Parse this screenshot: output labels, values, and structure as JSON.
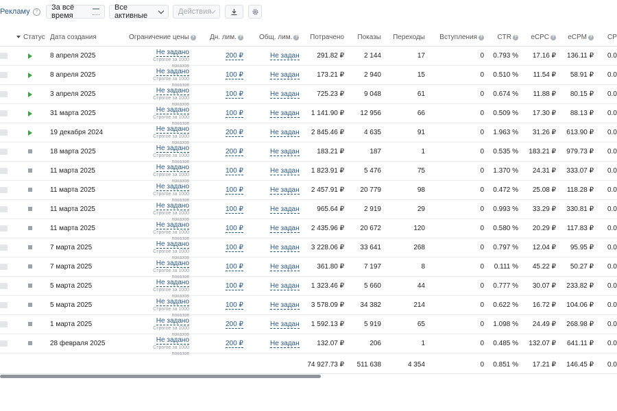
{
  "toolbar": {
    "create_label": "Рекламу",
    "period_label": "За всё время",
    "filter_label": "Все активные",
    "actions_label": "Действия",
    "help_glyph": "?"
  },
  "icons": {
    "calendar": "calendar-icon",
    "download": "download-icon",
    "settings": "gear-icon"
  },
  "columns": {
    "status": "Статус",
    "created": "Дата создания",
    "price_limit": "Ограничение цены",
    "daily_limit": "Дн. лим.",
    "total_limit": "Общ. лим.",
    "spent": "Потрачено",
    "views": "Показы",
    "clicks": "Переходы",
    "joins": "Вступления",
    "ctr": "CTR",
    "ecpc": "eCPC",
    "ecpm": "eCPM",
    "cpj": "CPJ"
  },
  "colors": {
    "link": "#2a5885",
    "active": "#3aa541",
    "stopped": "#99a2ad"
  },
  "rows": [
    {
      "status": "active",
      "created": "8 апреля 2025",
      "lim": "Не задано",
      "lim_note": "Строгое за 1000 показов",
      "daily": "200 ₽",
      "total_lim": "Не задан",
      "spent": "291.82 ₽",
      "views": "2 144",
      "clicks": "17",
      "joins": "0",
      "ctr": "0.793 %",
      "ecpc": "17.16 ₽",
      "ecpm": "136.11 ₽",
      "cpj": "0.0"
    },
    {
      "status": "active",
      "created": "8 апреля 2025",
      "lim": "Не задано",
      "lim_note": "Строгое за 1000 показов",
      "daily": "100 ₽",
      "total_lim": "Не задан",
      "spent": "173.21 ₽",
      "views": "2 940",
      "clicks": "15",
      "joins": "0",
      "ctr": "0.510 %",
      "ecpc": "11.54 ₽",
      "ecpm": "58.91 ₽",
      "cpj": "0.0"
    },
    {
      "status": "active",
      "created": "3 апреля 2025",
      "lim": "Не задано",
      "lim_note": "Строгое за 1000 показов",
      "daily": "100 ₽",
      "total_lim": "Не задан",
      "spent": "725.23 ₽",
      "views": "9 048",
      "clicks": "61",
      "joins": "0",
      "ctr": "0.674 %",
      "ecpc": "11.88 ₽",
      "ecpm": "80.15 ₽",
      "cpj": "0.0"
    },
    {
      "status": "active",
      "created": "31 марта 2025",
      "lim": "Не задано",
      "lim_note": "Строгое за 1000 показов",
      "daily": "100 ₽",
      "total_lim": "Не задан",
      "spent": "1 141.90 ₽",
      "views": "12 956",
      "clicks": "66",
      "joins": "0",
      "ctr": "0.509 %",
      "ecpc": "17.30 ₽",
      "ecpm": "88.13 ₽",
      "cpj": "0.0"
    },
    {
      "status": "active",
      "created": "19 декабря 2024",
      "lim": "Не задано",
      "lim_note": "Строгое за 1000 показов",
      "daily": "200 ₽",
      "total_lim": "Не задан",
      "spent": "2 845.46 ₽",
      "views": "4 635",
      "clicks": "91",
      "joins": "0",
      "ctr": "1.963 %",
      "ecpc": "31.26 ₽",
      "ecpm": "613.90 ₽",
      "cpj": "0.0"
    },
    {
      "status": "stopped",
      "created": "18 марта 2025",
      "lim": "Не задано",
      "lim_note": "Строгое за 1000 показов",
      "daily": "200 ₽",
      "total_lim": "Не задан",
      "spent": "183.21 ₽",
      "views": "187",
      "clicks": "1",
      "joins": "0",
      "ctr": "0.535 %",
      "ecpc": "183.21 ₽",
      "ecpm": "979.73 ₽",
      "cpj": "0.0"
    },
    {
      "status": "stopped",
      "created": "11 марта 2025",
      "lim": "Не задано",
      "lim_note": "Строгое за 1000 показов",
      "daily": "100 ₽",
      "total_lim": "Не задан",
      "spent": "1 823.91 ₽",
      "views": "5 476",
      "clicks": "75",
      "joins": "0",
      "ctr": "1.370 %",
      "ecpc": "24.31 ₽",
      "ecpm": "333.07 ₽",
      "cpj": "0.0"
    },
    {
      "status": "stopped",
      "created": "11 марта 2025",
      "lim": "Не задано",
      "lim_note": "Строгое за 1000 показов",
      "daily": "100 ₽",
      "total_lim": "Не задан",
      "spent": "2 457.91 ₽",
      "views": "20 779",
      "clicks": "98",
      "joins": "0",
      "ctr": "0.472 %",
      "ecpc": "25.08 ₽",
      "ecpm": "118.28 ₽",
      "cpj": "0.0"
    },
    {
      "status": "stopped",
      "created": "11 марта 2025",
      "lim": "Не задано",
      "lim_note": "Строгое за 1000 показов",
      "daily": "100 ₽",
      "total_lim": "Не задан",
      "spent": "965.64 ₽",
      "views": "2 919",
      "clicks": "29",
      "joins": "0",
      "ctr": "0.993 %",
      "ecpc": "33.29 ₽",
      "ecpm": "330.81 ₽",
      "cpj": "0.0"
    },
    {
      "status": "stopped",
      "created": "11 марта 2025",
      "lim": "Не задано",
      "lim_note": "Строгое за 1000 показов",
      "daily": "100 ₽",
      "total_lim": "Не задан",
      "spent": "2 435.96 ₽",
      "views": "20 672",
      "clicks": "120",
      "joins": "0",
      "ctr": "0.580 %",
      "ecpc": "20.29 ₽",
      "ecpm": "117.83 ₽",
      "cpj": "0.0"
    },
    {
      "status": "stopped",
      "created": "7 марта 2025",
      "lim": "Не задано",
      "lim_note": "Строгое за 1000 показов",
      "daily": "100 ₽",
      "total_lim": "Не задан",
      "spent": "3 228.06 ₽",
      "views": "33 641",
      "clicks": "268",
      "joins": "0",
      "ctr": "0.797 %",
      "ecpc": "12.04 ₽",
      "ecpm": "95.95 ₽",
      "cpj": "0.0"
    },
    {
      "status": "stopped",
      "created": "7 марта 2025",
      "lim": "Не задано",
      "lim_note": "Строгое за 1000 показов",
      "daily": "100 ₽",
      "total_lim": "Не задан",
      "spent": "361.80 ₽",
      "views": "7 197",
      "clicks": "8",
      "joins": "0",
      "ctr": "0.111 %",
      "ecpc": "45.22 ₽",
      "ecpm": "50.27 ₽",
      "cpj": "0.0"
    },
    {
      "status": "stopped",
      "created": "5 марта 2025",
      "lim": "Не задано",
      "lim_note": "Строгое за 1000 показов",
      "daily": "100 ₽",
      "total_lim": "Не задан",
      "spent": "1 323.46 ₽",
      "views": "5 660",
      "clicks": "44",
      "joins": "0",
      "ctr": "0.777 %",
      "ecpc": "30.07 ₽",
      "ecpm": "233.82 ₽",
      "cpj": "0.0"
    },
    {
      "status": "stopped",
      "created": "5 марта 2025",
      "lim": "Не задано",
      "lim_note": "Строгое за 1000 показов",
      "daily": "100 ₽",
      "total_lim": "Не задан",
      "spent": "3 578.09 ₽",
      "views": "34 382",
      "clicks": "214",
      "joins": "0",
      "ctr": "0.622 %",
      "ecpc": "16.72 ₽",
      "ecpm": "104.06 ₽",
      "cpj": "0.0"
    },
    {
      "status": "stopped",
      "created": "1 марта 2025",
      "lim": "Не задано",
      "lim_note": "Строгое за 1000 показов",
      "daily": "200 ₽",
      "total_lim": "Не задан",
      "spent": "1 592.13 ₽",
      "views": "5 919",
      "clicks": "65",
      "joins": "0",
      "ctr": "1.098 %",
      "ecpc": "24.49 ₽",
      "ecpm": "268.98 ₽",
      "cpj": "0.0"
    },
    {
      "status": "stopped",
      "created": "28 февраля 2025",
      "lim": "Не задано",
      "lim_note": "Строгое за 1000 показов",
      "daily": "200 ₽",
      "total_lim": "Не задан",
      "spent": "132.07 ₽",
      "views": "206",
      "clicks": "1",
      "joins": "0",
      "ctr": "0.485 %",
      "ecpc": "132.07 ₽",
      "ecpm": "641.11 ₽",
      "cpj": "0.0"
    }
  ],
  "totals": {
    "spent": "74 927.73 ₽",
    "views": "511 638",
    "clicks": "4 354",
    "joins": "0",
    "ctr": "0.851 %",
    "ecpc": "17.21 ₽",
    "ecpm": "146.45 ₽",
    "cpj": "0.0"
  }
}
